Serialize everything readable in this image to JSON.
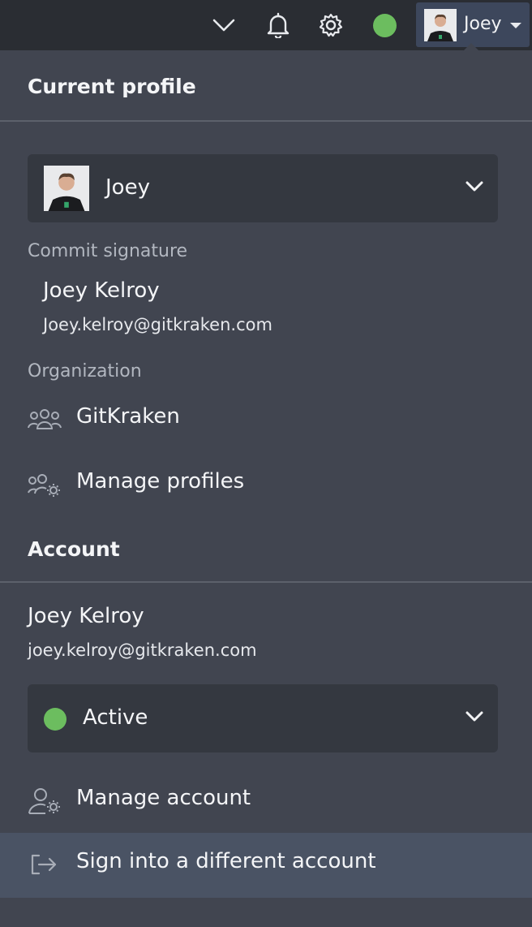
{
  "topbar": {
    "icons": [
      "chevron-down-icon",
      "bell-icon",
      "gear-icon",
      "status-dot"
    ],
    "status_color": "#6cbd5f",
    "profile_name": "Joey"
  },
  "current_profile": {
    "title": "Current profile",
    "selected_profile": "Joey",
    "commit_signature_label": "Commit signature",
    "commit_name": "Joey Kelroy",
    "commit_email": "Joey.kelroy@gitkraken.com",
    "organization_label": "Organization",
    "organization_name": "GitKraken",
    "manage_profiles_label": "Manage profiles"
  },
  "account": {
    "title": "Account",
    "name": "Joey Kelroy",
    "email": "joey.kelroy@gitkraken.com",
    "status": "Active",
    "status_color": "#6cbd5f",
    "manage_account_label": "Manage account",
    "sign_in_label": "Sign into a different account"
  }
}
